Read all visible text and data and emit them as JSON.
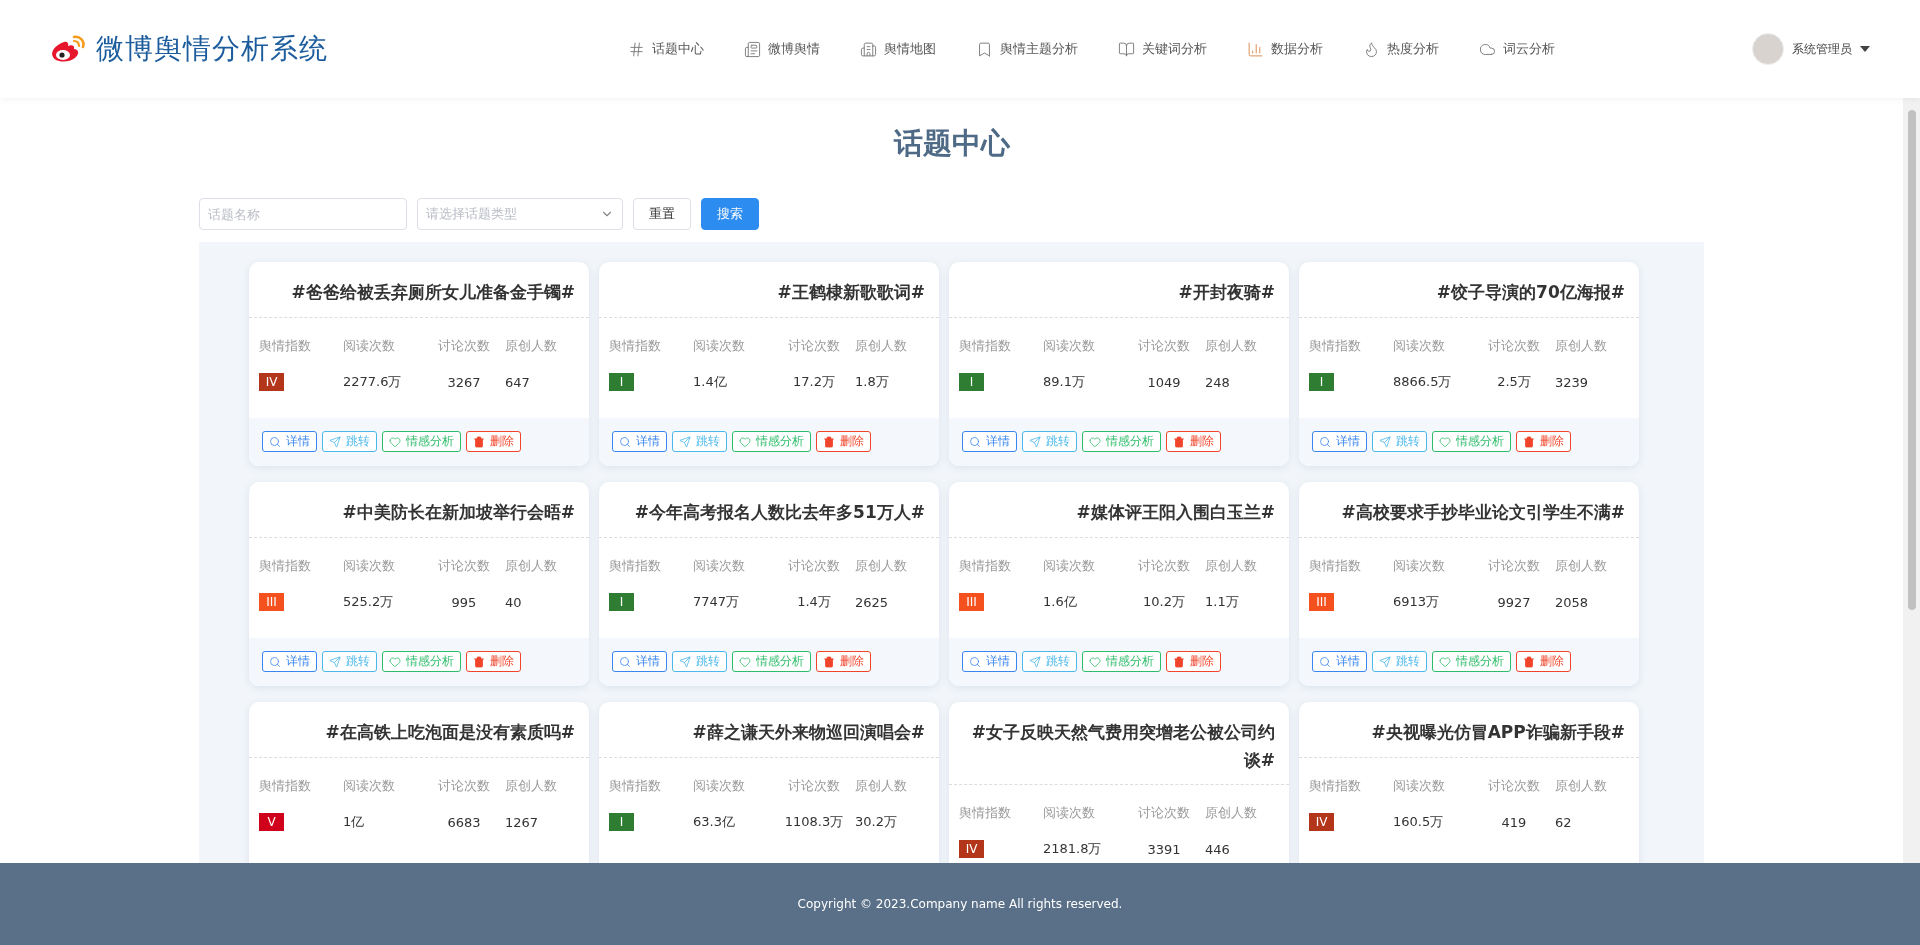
{
  "header": {
    "logo_text": "微博舆情分析系统",
    "nav": [
      {
        "label": "话题中心",
        "kind": "hash"
      },
      {
        "label": "微博舆情",
        "kind": "news"
      },
      {
        "label": "舆情地图",
        "kind": "map"
      },
      {
        "label": "舆情主题分析",
        "kind": "bookmark"
      },
      {
        "label": "关键词分析",
        "kind": "book"
      },
      {
        "label": "数据分析",
        "kind": "chart"
      },
      {
        "label": "热度分析",
        "kind": "heat"
      },
      {
        "label": "词云分析",
        "kind": "cloud"
      }
    ],
    "user": {
      "name": "系统管理员"
    }
  },
  "page_title": "话题中心",
  "filters": {
    "name_placeholder": "话题名称",
    "type_placeholder": "请选择话题类型",
    "buttons": [
      {
        "label": "重置",
        "kind": "reset"
      },
      {
        "label": "搜索",
        "kind": "search"
      }
    ]
  },
  "cards": [
    {
      "title": "#爸爸给被丢弃厕所女儿准备金手镯#",
      "metrics": [
        {
          "label": "舆情指数",
          "value": "IV",
          "kind": "badge",
          "color": "#b3361a"
        },
        {
          "label": "阅读次数",
          "value": "2277.6万",
          "kind": "text"
        },
        {
          "label": "讨论次数",
          "value": "3267",
          "kind": "text"
        },
        {
          "label": "原创人数",
          "value": "647",
          "kind": "text"
        }
      ],
      "actions": [
        {
          "label": "详情",
          "kind": "detail",
          "color": "#3a86f0"
        },
        {
          "label": "跳转",
          "kind": "jump",
          "color": "#4bb8ec"
        },
        {
          "label": "情感分析",
          "kind": "sentiment",
          "color": "#2dbd6a"
        },
        {
          "label": "删除",
          "kind": "delete",
          "color": "#f0452a"
        }
      ]
    },
    {
      "title": "#王鹤棣新歌歌词#",
      "metrics": [
        {
          "label": "舆情指数",
          "value": "I",
          "kind": "badge",
          "color": "#2e7d32"
        },
        {
          "label": "阅读次数",
          "value": "1.4亿",
          "kind": "text"
        },
        {
          "label": "讨论次数",
          "value": "17.2万",
          "kind": "text"
        },
        {
          "label": "原创人数",
          "value": "1.8万",
          "kind": "text"
        }
      ],
      "actions": [
        {
          "label": "详情",
          "kind": "detail",
          "color": "#3a86f0"
        },
        {
          "label": "跳转",
          "kind": "jump",
          "color": "#4bb8ec"
        },
        {
          "label": "情感分析",
          "kind": "sentiment",
          "color": "#2dbd6a"
        },
        {
          "label": "删除",
          "kind": "delete",
          "color": "#f0452a"
        }
      ]
    },
    {
      "title": "#开封夜骑#",
      "metrics": [
        {
          "label": "舆情指数",
          "value": "I",
          "kind": "badge",
          "color": "#2e7d32"
        },
        {
          "label": "阅读次数",
          "value": "89.1万",
          "kind": "text"
        },
        {
          "label": "讨论次数",
          "value": "1049",
          "kind": "text"
        },
        {
          "label": "原创人数",
          "value": "248",
          "kind": "text"
        }
      ],
      "actions": [
        {
          "label": "详情",
          "kind": "detail",
          "color": "#3a86f0"
        },
        {
          "label": "跳转",
          "kind": "jump",
          "color": "#4bb8ec"
        },
        {
          "label": "情感分析",
          "kind": "sentiment",
          "color": "#2dbd6a"
        },
        {
          "label": "删除",
          "kind": "delete",
          "color": "#f0452a"
        }
      ]
    },
    {
      "title": "#饺子导演的70亿海报#",
      "metrics": [
        {
          "label": "舆情指数",
          "value": "I",
          "kind": "badge",
          "color": "#2e7d32"
        },
        {
          "label": "阅读次数",
          "value": "8866.5万",
          "kind": "text"
        },
        {
          "label": "讨论次数",
          "value": "2.5万",
          "kind": "text"
        },
        {
          "label": "原创人数",
          "value": "3239",
          "kind": "text"
        }
      ],
      "actions": [
        {
          "label": "详情",
          "kind": "detail",
          "color": "#3a86f0"
        },
        {
          "label": "跳转",
          "kind": "jump",
          "color": "#4bb8ec"
        },
        {
          "label": "情感分析",
          "kind": "sentiment",
          "color": "#2dbd6a"
        },
        {
          "label": "删除",
          "kind": "delete",
          "color": "#f0452a"
        }
      ]
    },
    {
      "title": "#中美防长在新加坡举行会晤#",
      "metrics": [
        {
          "label": "舆情指数",
          "value": "III",
          "kind": "badge",
          "color": "#f4511e"
        },
        {
          "label": "阅读次数",
          "value": "525.2万",
          "kind": "text"
        },
        {
          "label": "讨论次数",
          "value": "995",
          "kind": "text"
        },
        {
          "label": "原创人数",
          "value": "40",
          "kind": "text"
        }
      ],
      "actions": [
        {
          "label": "详情",
          "kind": "detail",
          "color": "#3a86f0"
        },
        {
          "label": "跳转",
          "kind": "jump",
          "color": "#4bb8ec"
        },
        {
          "label": "情感分析",
          "kind": "sentiment",
          "color": "#2dbd6a"
        },
        {
          "label": "删除",
          "kind": "delete",
          "color": "#f0452a"
        }
      ]
    },
    {
      "title": "#今年高考报名人数比去年多51万人#",
      "metrics": [
        {
          "label": "舆情指数",
          "value": "I",
          "kind": "badge",
          "color": "#2e7d32"
        },
        {
          "label": "阅读次数",
          "value": "7747万",
          "kind": "text"
        },
        {
          "label": "讨论次数",
          "value": "1.4万",
          "kind": "text"
        },
        {
          "label": "原创人数",
          "value": "2625",
          "kind": "text"
        }
      ],
      "actions": [
        {
          "label": "详情",
          "kind": "detail",
          "color": "#3a86f0"
        },
        {
          "label": "跳转",
          "kind": "jump",
          "color": "#4bb8ec"
        },
        {
          "label": "情感分析",
          "kind": "sentiment",
          "color": "#2dbd6a"
        },
        {
          "label": "删除",
          "kind": "delete",
          "color": "#f0452a"
        }
      ]
    },
    {
      "title": "#媒体评王阳入围白玉兰#",
      "metrics": [
        {
          "label": "舆情指数",
          "value": "III",
          "kind": "badge",
          "color": "#f4511e"
        },
        {
          "label": "阅读次数",
          "value": "1.6亿",
          "kind": "text"
        },
        {
          "label": "讨论次数",
          "value": "10.2万",
          "kind": "text"
        },
        {
          "label": "原创人数",
          "value": "1.1万",
          "kind": "text"
        }
      ],
      "actions": [
        {
          "label": "详情",
          "kind": "detail",
          "color": "#3a86f0"
        },
        {
          "label": "跳转",
          "kind": "jump",
          "color": "#4bb8ec"
        },
        {
          "label": "情感分析",
          "kind": "sentiment",
          "color": "#2dbd6a"
        },
        {
          "label": "删除",
          "kind": "delete",
          "color": "#f0452a"
        }
      ]
    },
    {
      "title": "#高校要求手抄毕业论文引学生不满#",
      "metrics": [
        {
          "label": "舆情指数",
          "value": "III",
          "kind": "badge",
          "color": "#f4511e"
        },
        {
          "label": "阅读次数",
          "value": "6913万",
          "kind": "text"
        },
        {
          "label": "讨论次数",
          "value": "9927",
          "kind": "text"
        },
        {
          "label": "原创人数",
          "value": "2058",
          "kind": "text"
        }
      ],
      "actions": [
        {
          "label": "详情",
          "kind": "detail",
          "color": "#3a86f0"
        },
        {
          "label": "跳转",
          "kind": "jump",
          "color": "#4bb8ec"
        },
        {
          "label": "情感分析",
          "kind": "sentiment",
          "color": "#2dbd6a"
        },
        {
          "label": "删除",
          "kind": "delete",
          "color": "#f0452a"
        }
      ]
    },
    {
      "title": "#在高铁上吃泡面是没有素质吗#",
      "metrics": [
        {
          "label": "舆情指数",
          "value": "V",
          "kind": "badge",
          "color": "#d0021b"
        },
        {
          "label": "阅读次数",
          "value": "1亿",
          "kind": "text"
        },
        {
          "label": "讨论次数",
          "value": "6683",
          "kind": "text"
        },
        {
          "label": "原创人数",
          "value": "1267",
          "kind": "text"
        }
      ]
    },
    {
      "title": "#薛之谦天外来物巡回演唱会#",
      "metrics": [
        {
          "label": "舆情指数",
          "value": "I",
          "kind": "badge",
          "color": "#2e7d32"
        },
        {
          "label": "阅读次数",
          "value": "63.3亿",
          "kind": "text"
        },
        {
          "label": "讨论次数",
          "value": "1108.3万",
          "kind": "text"
        },
        {
          "label": "原创人数",
          "value": "30.2万",
          "kind": "text"
        }
      ]
    },
    {
      "title": "#女子反映天然气费用突增老公被公司约谈#",
      "metrics": [
        {
          "label": "舆情指数",
          "value": "IV",
          "kind": "badge",
          "color": "#b3361a"
        },
        {
          "label": "阅读次数",
          "value": "2181.8万",
          "kind": "text"
        },
        {
          "label": "讨论次数",
          "value": "3391",
          "kind": "text"
        },
        {
          "label": "原创人数",
          "value": "446",
          "kind": "text"
        }
      ]
    },
    {
      "title": "#央视曝光仿冒APP诈骗新手段#",
      "metrics": [
        {
          "label": "舆情指数",
          "value": "IV",
          "kind": "badge",
          "color": "#b3361a"
        },
        {
          "label": "阅读次数",
          "value": "160.5万",
          "kind": "text"
        },
        {
          "label": "讨论次数",
          "value": "419",
          "kind": "text"
        },
        {
          "label": "原创人数",
          "value": "62",
          "kind": "text"
        }
      ]
    }
  ],
  "footer": {
    "text": "Copyright © 2023.Company name All rights reserved."
  }
}
